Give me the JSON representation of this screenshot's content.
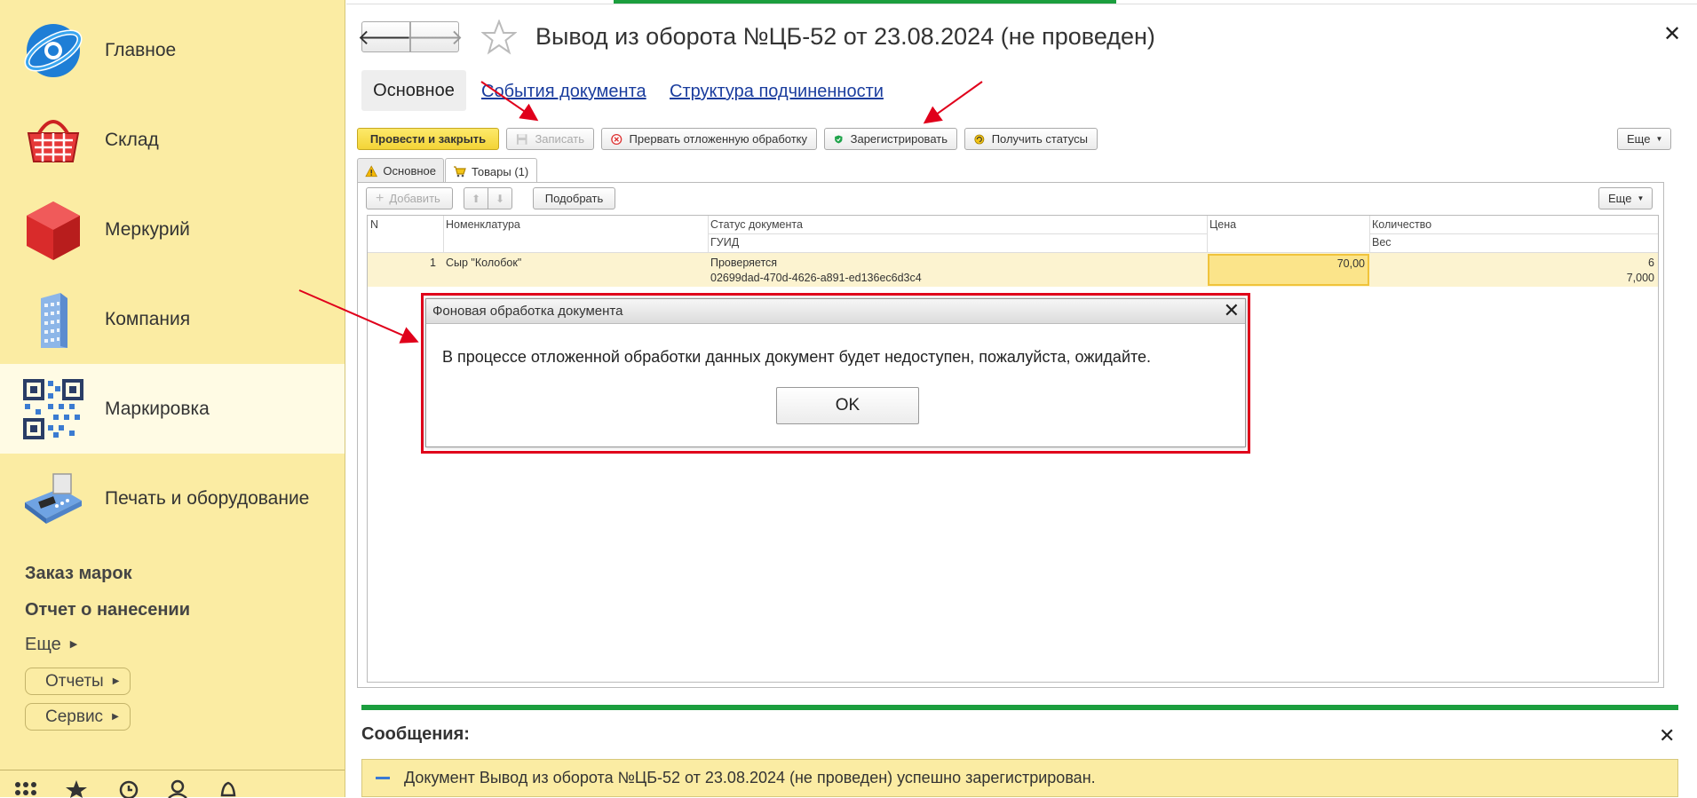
{
  "sidebar": {
    "sections": [
      {
        "label": "Главное",
        "icon": "globe-logo-icon"
      },
      {
        "label": "Склад",
        "icon": "basket-icon"
      },
      {
        "label": "Меркурий",
        "icon": "cube-icon"
      },
      {
        "label": "Компания",
        "icon": "building-icon"
      },
      {
        "label": "Маркировка",
        "icon": "qr-code-icon"
      },
      {
        "label": "Печать и оборудование",
        "icon": "payment-terminal-icon"
      }
    ],
    "links": [
      "Заказ марок",
      "Отчет о нанесении"
    ],
    "more_label": "Еще",
    "buttons": [
      "Отчеты",
      "Сервис"
    ]
  },
  "header": {
    "title": "Вывод из оборота №ЦБ-52 от 23.08.2024 (не проведен)"
  },
  "form_tabs": {
    "main": "Основное",
    "events": "События документа",
    "structure": "Структура подчиненности"
  },
  "toolbar": {
    "post_close": "Провести и закрыть",
    "save": "Записать",
    "interrupt": "Прервать отложенную обработку",
    "register": "Зарегистрировать",
    "get_status": "Получить статусы",
    "more": "Еще"
  },
  "page_tabs": {
    "basic": "Основное",
    "goods": "Товары (1)"
  },
  "table_toolbar": {
    "add": "Добавить",
    "pick": "Подобрать",
    "more": "Еще"
  },
  "table": {
    "headers": {
      "n": "N",
      "nomenclature": "Номенклатура",
      "status": "Статус документа",
      "guid": "ГУИД",
      "price": "Цена",
      "quantity": "Количество",
      "weight": "Вес"
    },
    "rows": [
      {
        "n": "1",
        "nomenclature": "Сыр \"Колобок\"",
        "status": "Проверяется",
        "guid": "02699dad-470d-4626-a891-ed136ec6d3c4",
        "price": "70,00",
        "quantity": "6",
        "weight": "7,000"
      }
    ]
  },
  "dialog": {
    "title": "Фоновая обработка документа",
    "message": "В процессе отложенной обработки данных документ будет недоступен, пожалуйста, ожидайте.",
    "ok": "OK"
  },
  "messages": {
    "title": "Сообщения:",
    "items": [
      "Документ Вывод из оборота №ЦБ-52 от 23.08.2024 (не проведен) успешно зарегистрирован."
    ]
  },
  "colors": {
    "sidebar_bg": "#fbeca3",
    "accent_green": "#1b9e3e",
    "highlight_red": "#e0001b",
    "link_blue": "#1a3d9e",
    "primary_button": "#f3d437"
  }
}
